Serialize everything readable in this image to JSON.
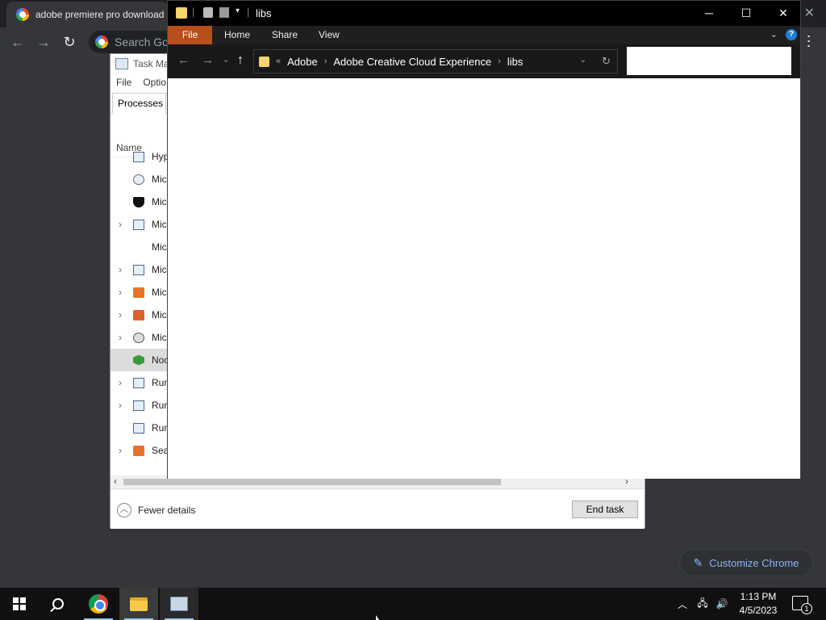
{
  "chrome": {
    "tab_title": "adobe premiere pro download",
    "omnibox_placeholder": "Search Goo",
    "customize_label": "Customize Chrome"
  },
  "taskmgr": {
    "title": "Task Ma",
    "menu": [
      "File",
      "Optio"
    ],
    "tab_processes": "Processes",
    "col_name": "Name",
    "rows": [
      {
        "name": "Hyp",
        "icon": "app-window-icon",
        "expand": false
      },
      {
        "name": "Mic",
        "icon": "magnifier-gear-icon",
        "expand": false
      },
      {
        "name": "Mic",
        "icon": "shield-icon",
        "expand": false
      },
      {
        "name": "Mic",
        "icon": "app-window-icon",
        "expand": true
      },
      {
        "name": "Mic",
        "icon": "",
        "expand": false
      },
      {
        "name": "Mic",
        "icon": "app-window-icon",
        "expand": true
      },
      {
        "name": "Mic",
        "icon": "store-bag-icon",
        "expand": true
      },
      {
        "name": "Mic",
        "icon": "keyboard-icon",
        "expand": true
      },
      {
        "name": "Mic",
        "icon": "search-person-icon",
        "expand": true
      },
      {
        "name": "Noc",
        "icon": "node-hexagon-icon",
        "expand": false,
        "selected": true
      },
      {
        "name": "Run",
        "icon": "app-window-icon",
        "expand": true
      },
      {
        "name": "Run",
        "icon": "app-window-icon",
        "expand": true
      },
      {
        "name": "Run",
        "icon": "app-window-icon",
        "expand": false
      },
      {
        "name": "Sear",
        "icon": "search-orange-icon",
        "expand": true
      }
    ],
    "fewer_details": "Fewer details",
    "end_task": "End task"
  },
  "explorer": {
    "title": "libs",
    "ribbon_tabs": [
      "File",
      "Home",
      "Share",
      "View"
    ],
    "breadcrumb": [
      "Adobe",
      "Adobe Creative Cloud Experience",
      "libs"
    ],
    "breadcrumb_overflow": "«",
    "help_label": "?",
    "colors": {
      "file_tab": "#b84f1a",
      "title_bg": "#000000"
    }
  },
  "taskbar": {
    "time": "1:13 PM",
    "date": "4/5/2023",
    "notification_count": "1"
  }
}
